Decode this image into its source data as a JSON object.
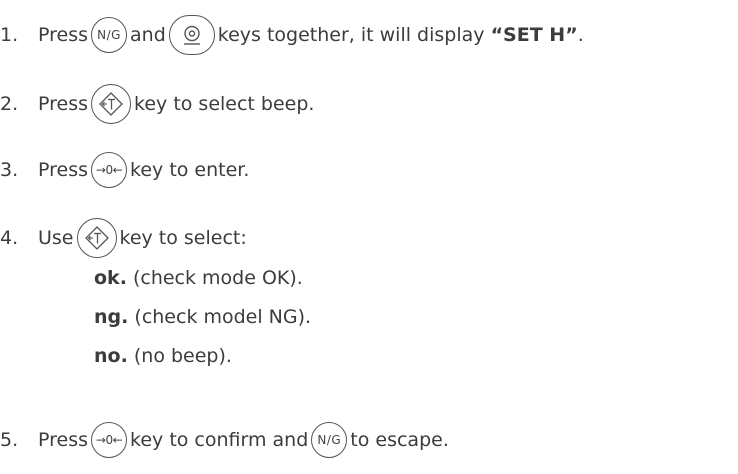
{
  "steps": [
    {
      "num": "1.",
      "pre": "Press",
      "key1": "N/G",
      "mid": "and",
      "post": "keys together, it will display",
      "display_text": "“SET H”",
      "end": "."
    },
    {
      "num": "2.",
      "pre": "Press",
      "post": "key to select beep."
    },
    {
      "num": "3.",
      "pre": "Press",
      "key": "→0←",
      "post": "key to enter."
    },
    {
      "num": "4.",
      "pre": "Use",
      "post": "key to select:"
    },
    {
      "num": "5.",
      "pre": "Press",
      "key1": "→0←",
      "mid": "key to confirm and",
      "key2": "N/G",
      "post": "to escape."
    }
  ],
  "options": [
    {
      "code": "ok.",
      "desc": "(check mode OK)."
    },
    {
      "code": "ng.",
      "desc": "(check model NG)."
    },
    {
      "code": "no.",
      "desc": "(no beep)."
    }
  ],
  "icons": {
    "unit_key": "target-icon",
    "tare_key": "tare-diamond-icon"
  }
}
